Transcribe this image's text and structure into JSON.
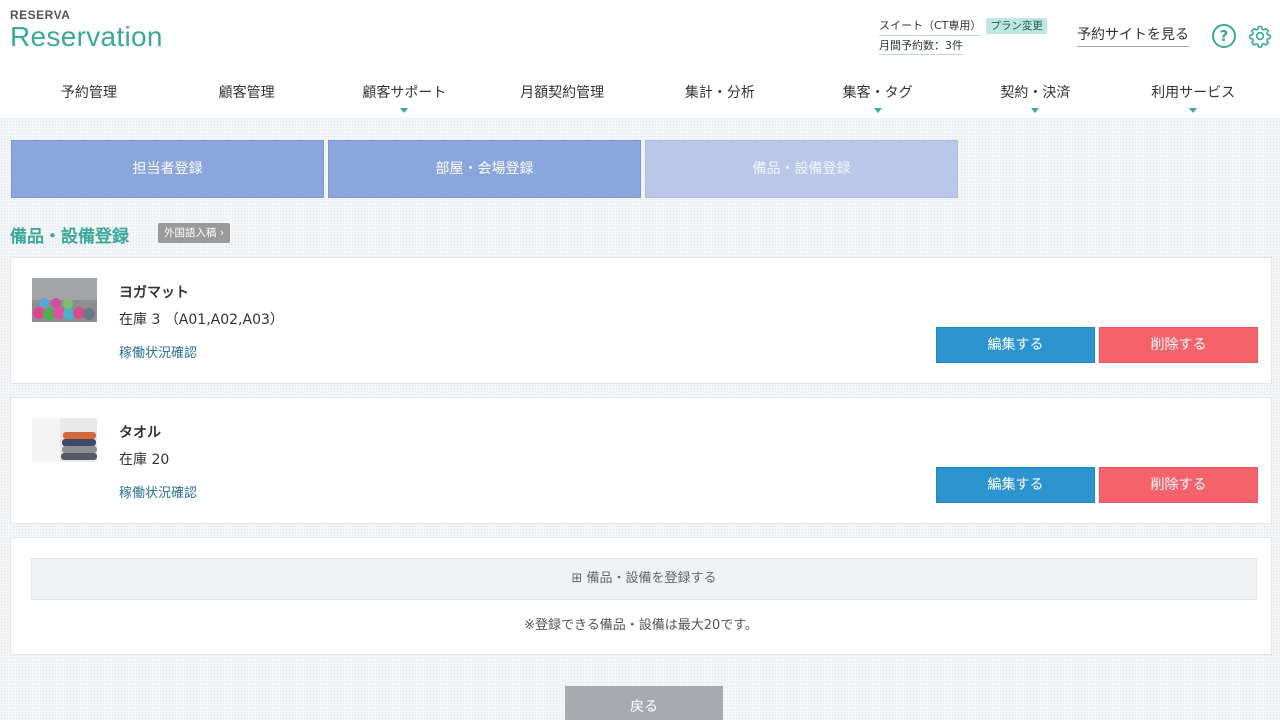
{
  "header": {
    "logo_small": "RESERVA",
    "logo_main": "Reservation",
    "plan_name": "スイート（CT専用）",
    "plan_change": "プラン変更",
    "monthly_count": "月間予約数：3件",
    "view_site": "予約サイトを見る",
    "help_symbol": "?",
    "help_icon": "help-icon",
    "settings_icon": "gear-icon"
  },
  "nav": {
    "items": [
      {
        "label": "予約管理",
        "has_dropdown": false
      },
      {
        "label": "顧客管理",
        "has_dropdown": false
      },
      {
        "label": "顧客サポート",
        "has_dropdown": true
      },
      {
        "label": "月額契約管理",
        "has_dropdown": false
      },
      {
        "label": "集計・分析",
        "has_dropdown": false
      },
      {
        "label": "集客・タグ",
        "has_dropdown": true
      },
      {
        "label": "契約・決済",
        "has_dropdown": true
      },
      {
        "label": "利用サービス",
        "has_dropdown": true
      }
    ]
  },
  "subtabs": [
    {
      "label": "担当者登録",
      "active": false
    },
    {
      "label": "部屋・会場登録",
      "active": false
    },
    {
      "label": "備品・設備登録",
      "active": true
    }
  ],
  "section": {
    "title": "備品・設備登録",
    "lang_badge": "外国語入稿 ›"
  },
  "items": [
    {
      "name": "ヨガマット",
      "stock": "在庫 3 （A01,A02,A03）",
      "status_link": "稼働状況確認",
      "edit_label": "編集する",
      "delete_label": "削除する"
    },
    {
      "name": "タオル",
      "stock": "在庫 20",
      "status_link": "稼働状況確認",
      "edit_label": "編集する",
      "delete_label": "削除する"
    }
  ],
  "register": {
    "button_label": "⊞ 備品・設備を登録する",
    "note": "※登録できる備品・設備は最大20です。"
  },
  "back_label": "戻る",
  "colors": {
    "accent": "#3aa89b",
    "tab": "#8aa6dc",
    "tab_active": "#b9c8e8",
    "edit": "#2c95cf",
    "delete": "#f6626c",
    "back": "#a7abb0"
  }
}
